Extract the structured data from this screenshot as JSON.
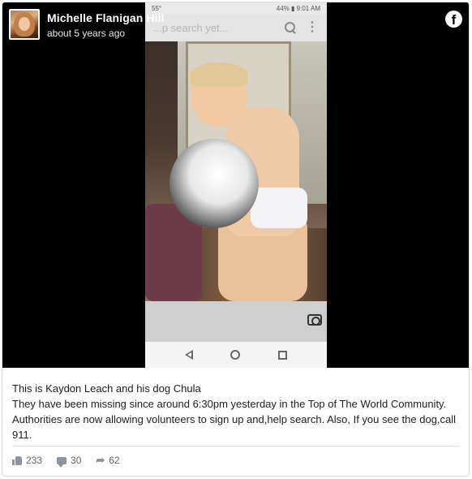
{
  "post": {
    "author": "Michelle Flanigan Hill",
    "timestamp": "about 5 years ago",
    "caption_lines": [
      "This is Kaydon Leach and his dog Chula",
      "They have been missing since around 6:30pm yesterday in the Top of The World Community. Authorities are now allowing volunteers to sign up and,help search. Also, If you see the dog,call 911."
    ]
  },
  "phone_screenshot": {
    "status_left": "55°",
    "status_right": "44% ▮ 9:01 AM",
    "search_ghost_text": "...p search yet..."
  },
  "brand": {
    "logo_glyph": "f",
    "logo_color": "#ffffff"
  },
  "stats": {
    "likes": "233",
    "comments": "30",
    "shares": "62"
  },
  "icons": [
    "facebook-icon",
    "search-icon",
    "more-icon",
    "camera-icon",
    "nav-back-icon",
    "nav-home-icon",
    "nav-recent-icon",
    "like-icon",
    "comment-icon",
    "share-icon"
  ]
}
